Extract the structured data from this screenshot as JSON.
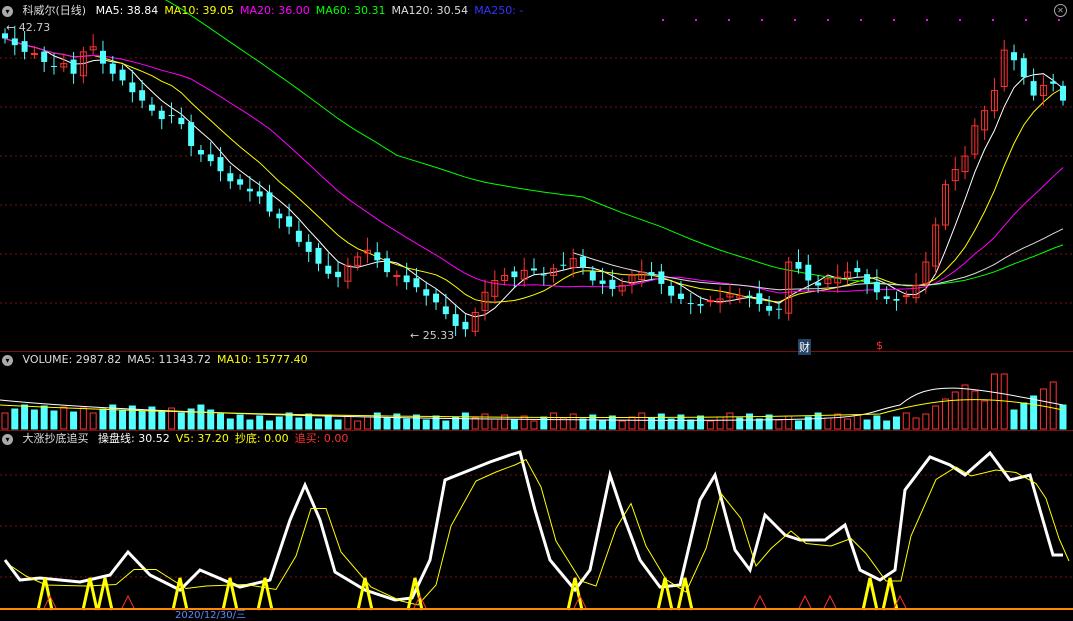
{
  "main_panel": {
    "title": "科威尔(日线)",
    "indicators": [
      {
        "label": "MA5: 38.84",
        "color": "#ffffff"
      },
      {
        "label": "MA10: 39.05",
        "color": "#ffff00"
      },
      {
        "label": "MA20: 36.00",
        "color": "#ff00ff"
      },
      {
        "label": "MA60: 30.31",
        "color": "#00ff00"
      },
      {
        "label": "MA120: 30.54",
        "color": "#dddddd"
      },
      {
        "label": "MA250: -",
        "color": "#3333ff"
      }
    ],
    "high_label": "42.73",
    "low_label": "25.33",
    "marker_cai": "财",
    "marker_s": "$"
  },
  "volume_panel": {
    "items": [
      {
        "label": "VOLUME: 2987.82",
        "color": "#dddddd"
      },
      {
        "label": "MA5: 11343.72",
        "color": "#dddddd"
      },
      {
        "label": "MA10: 15777.40",
        "color": "#ffff00"
      }
    ]
  },
  "indicator_panel": {
    "title": "大涨抄底追买",
    "items": [
      {
        "label": "操盘线: 30.52",
        "color": "#ffffff"
      },
      {
        "label": "V5: 37.20",
        "color": "#ffff00"
      },
      {
        "label": "抄底: 0.00",
        "color": "#ffff00"
      },
      {
        "label": "追买: 0.00",
        "color": "#ff3030"
      }
    ]
  },
  "axis": {
    "date_label": "2020/12/30/三"
  },
  "colors": {
    "up": "#ff3232",
    "down": "#54ffff",
    "grid": "#7a1010",
    "ma5": "#ffffff",
    "ma10": "#ffff00",
    "ma20": "#ff00ff",
    "ma60": "#00ff00",
    "ma120": "#dddddd"
  },
  "chart_data": {
    "type": "candlestick",
    "closes": [
      42.7,
      42.3,
      41.9,
      41.8,
      41.3,
      41.0,
      41.2,
      40.6,
      41.9,
      42.2,
      41.2,
      40.6,
      40.2,
      39.5,
      39.0,
      38.4,
      37.9,
      38.1,
      37.6,
      36.3,
      35.8,
      35.4,
      34.8,
      34.2,
      34.0,
      33.6,
      33.3,
      32.4,
      32.0,
      31.5,
      30.6,
      30.0,
      29.3,
      28.7,
      28.5,
      29.2,
      29.7,
      30.1,
      29.5,
      28.8,
      28.6,
      28.2,
      27.9,
      27.4,
      27.0,
      26.3,
      25.6,
      25.4,
      26.4,
      27.6,
      28.3,
      28.6,
      28.5,
      28.9,
      28.9,
      28.6,
      29.0,
      29.2,
      29.6,
      29.1,
      28.3,
      28.1,
      27.8,
      28.0,
      28.6,
      28.8,
      28.6,
      28.1,
      27.4,
      27.2,
      26.9,
      26.8,
      27.1,
      27.2,
      27.5,
      27.4,
      27.3,
      26.9,
      26.5,
      26.6,
      29.4,
      29.0,
      28.3,
      28.0,
      28.4,
      28.5,
      28.8,
      28.8,
      28.1,
      27.6,
      27.2,
      27.1,
      27.4,
      28.0,
      29.4,
      31.6,
      34.0,
      34.9,
      35.7,
      37.5,
      38.4,
      39.6,
      42.0,
      41.4,
      40.4,
      39.3,
      39.9,
      40.0,
      39.0
    ]
  }
}
